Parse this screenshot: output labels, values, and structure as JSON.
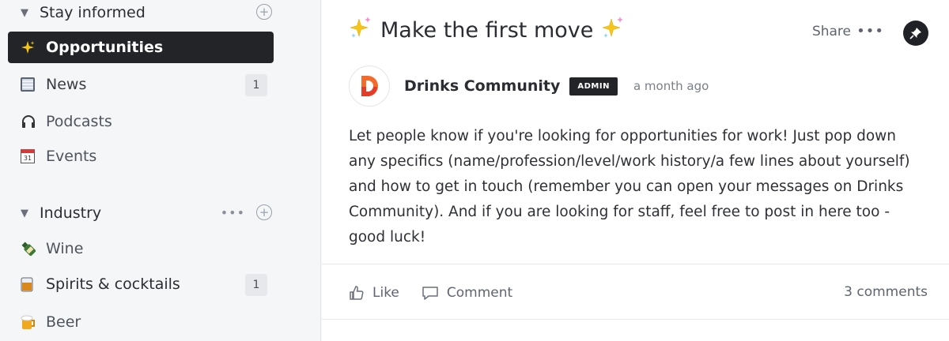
{
  "sidebar": {
    "groups": [
      {
        "label": "Stay informed"
      },
      {
        "label": "Industry"
      }
    ],
    "items": [
      {
        "label": "Opportunities",
        "icon": "sparkles-icon",
        "active": true
      },
      {
        "label": "News",
        "icon": "newspaper-icon",
        "count": "1"
      },
      {
        "label": "Podcasts",
        "icon": "headphones-icon"
      },
      {
        "label": "Events",
        "icon": "calendar-icon",
        "calendar_day": "31"
      },
      {
        "label": "Wine",
        "icon": "wine-bottle-icon"
      },
      {
        "label": "Spirits & cocktails",
        "icon": "whisky-glass-icon",
        "count": "1"
      },
      {
        "label": "Beer",
        "icon": "beer-mug-icon"
      }
    ]
  },
  "post": {
    "title": "Make the first move",
    "share_label": "Share",
    "author": "Drinks Community",
    "badge": "ADMIN",
    "time": "a month ago",
    "body": "Let people know if you're looking for opportunities for work! Just pop down any specifics (name/profession/level/work history/a few lines about yourself) and how to get in touch (remember you can open your messages on Drinks Community). And if you are looking for staff, feel free to post in here too - good luck!",
    "like_label": "Like",
    "comment_label": "Comment",
    "comments_count": "3 comments"
  },
  "colors": {
    "active_bg": "#222428",
    "logo_orange": "#f26b2a",
    "logo_red": "#e23d28"
  }
}
